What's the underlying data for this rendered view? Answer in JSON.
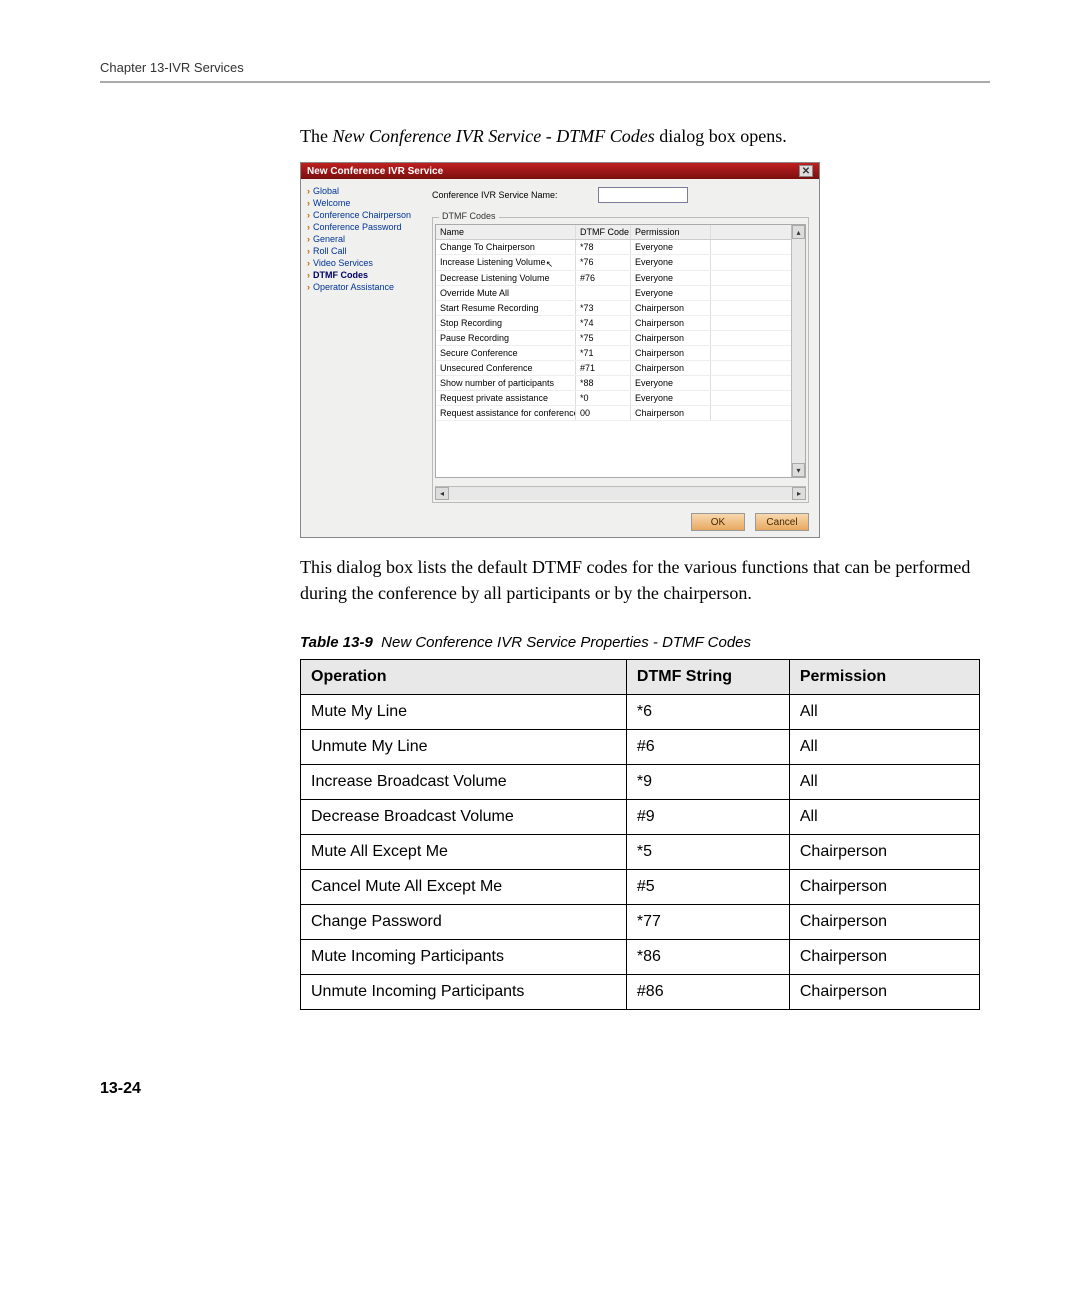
{
  "header": {
    "chapter": "Chapter 13-IVR Services"
  },
  "intro": {
    "prefix": "The ",
    "italic": "New Conference IVR Service - DTMF Codes",
    "suffix": " dialog box opens."
  },
  "dialog": {
    "title": "New Conference IVR Service",
    "name_label": "Conference IVR Service Name:",
    "group_title": "DTMF Codes",
    "sidebar": [
      {
        "label": "Global"
      },
      {
        "label": "Welcome"
      },
      {
        "label": "Conference Chairperson"
      },
      {
        "label": "Conference Password"
      },
      {
        "label": "General"
      },
      {
        "label": "Roll Call"
      },
      {
        "label": "Video Services"
      },
      {
        "label": "DTMF Codes",
        "selected": true
      },
      {
        "label": "Operator Assistance"
      }
    ],
    "columns": {
      "name": "Name",
      "code": "DTMF Code",
      "perm": "Permission"
    },
    "rows": [
      {
        "name": "Change To Chairperson",
        "code": "*78",
        "perm": "Everyone"
      },
      {
        "name": "Increase Listening Volume",
        "code": "*76",
        "perm": "Everyone",
        "cursor": true
      },
      {
        "name": "Decrease Listening Volume",
        "code": "#76",
        "perm": "Everyone"
      },
      {
        "name": "Override Mute All",
        "code": "",
        "perm": "Everyone"
      },
      {
        "name": "Start Resume Recording",
        "code": "*73",
        "perm": "Chairperson"
      },
      {
        "name": "Stop Recording",
        "code": "*74",
        "perm": "Chairperson"
      },
      {
        "name": "Pause Recording",
        "code": "*75",
        "perm": "Chairperson"
      },
      {
        "name": "Secure Conference",
        "code": "*71",
        "perm": "Chairperson"
      },
      {
        "name": "Unsecured Conference",
        "code": "#71",
        "perm": "Chairperson"
      },
      {
        "name": "Show number of participants",
        "code": "*88",
        "perm": "Everyone"
      },
      {
        "name": "Request private assistance",
        "code": "*0",
        "perm": "Everyone"
      },
      {
        "name": "Request assistance for conference",
        "code": "00",
        "perm": "Chairperson"
      }
    ],
    "ok": "OK",
    "cancel": "Cancel"
  },
  "explain": "This dialog box lists the default DTMF codes for the various functions that can be performed during the conference by all participants or by the chairperson.",
  "table_caption": {
    "label": "Table 13-9",
    "title": "New Conference IVR Service Properties - DTMF Codes"
  },
  "table": {
    "headers": {
      "op": "Operation",
      "str": "DTMF String",
      "perm": "Permission"
    },
    "rows": [
      {
        "op": "Mute My Line",
        "str": "*6",
        "perm": "All"
      },
      {
        "op": "Unmute My Line",
        "str": "#6",
        "perm": "All"
      },
      {
        "op": "Increase Broadcast Volume",
        "str": "*9",
        "perm": "All"
      },
      {
        "op": "Decrease Broadcast Volume",
        "str": "#9",
        "perm": "All"
      },
      {
        "op": "Mute All Except Me",
        "str": "*5",
        "perm": "Chairperson"
      },
      {
        "op": "Cancel Mute All Except Me",
        "str": "#5",
        "perm": "Chairperson"
      },
      {
        "op": "Change Password",
        "str": "*77",
        "perm": "Chairperson"
      },
      {
        "op": "Mute Incoming Participants",
        "str": "*86",
        "perm": "Chairperson"
      },
      {
        "op": "Unmute Incoming Participants",
        "str": "#86",
        "perm": "Chairperson"
      }
    ]
  },
  "page_num": "13-24"
}
